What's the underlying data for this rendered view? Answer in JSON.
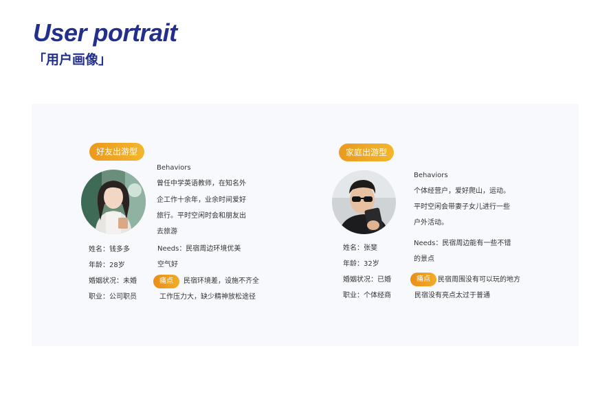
{
  "header": {
    "title": "User portrait",
    "subtitle": "「用户画像」"
  },
  "personas": [
    {
      "tag": "好友出游型",
      "avatar": "young-woman-photo",
      "name": "姓名：钱多多",
      "age": "年龄：28岁",
      "marital": "婚姻状况：未婚",
      "job": "职业：公司职员",
      "behaviors_label": "Behaviors",
      "behaviors": [
        "曾任中学英语教师，在知名外",
        "企工作十余年，业余时间爱好",
        "旅行。平时空闲时会和朋友出",
        "去旅游"
      ],
      "needs": [
        "Needs：民宿周边环境优美",
        "空气好"
      ],
      "pain_label": "痛点",
      "pain": [
        "民宿环境差，设施不齐全",
        "工作压力大，缺少精神放松途径"
      ]
    },
    {
      "tag": "家庭出游型",
      "avatar": "man-sunglasses-photo",
      "name": "姓名：张斐",
      "age": "年龄：32岁",
      "marital": "婚姻状况：已婚",
      "job": "职业：个体经商",
      "behaviors_label": "Behaviors",
      "behaviors": [
        "个体经营户，爱好爬山，运动。",
        "平时空闲会带妻子女儿进行一些",
        "户外活动。"
      ],
      "needs": [
        "Needs：民宿周边能有一些不错",
        "的景点"
      ],
      "pain_label": "痛点",
      "pain": [
        "民宿周围没有可以玩的地方",
        "民宿没有亮点太过于普通"
      ]
    }
  ],
  "colors": {
    "title": "#22308c",
    "accent": "#ea9a1f",
    "panel": "#f8f9fd"
  }
}
